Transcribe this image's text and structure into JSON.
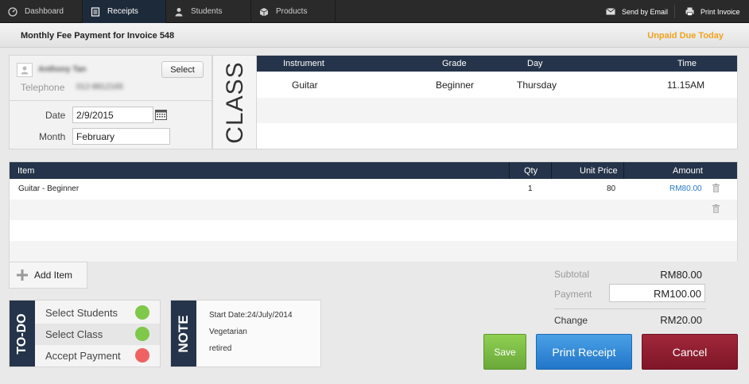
{
  "nav": {
    "tabs": [
      {
        "label": "Dashboard",
        "icon": "dashboard-icon"
      },
      {
        "label": "Receipts",
        "icon": "receipt-icon"
      },
      {
        "label": "Students",
        "icon": "person-icon"
      },
      {
        "label": "Products",
        "icon": "box-icon"
      }
    ],
    "actions": [
      {
        "label": "Send by Email",
        "icon": "envelope-icon"
      },
      {
        "label": "Print Invoice",
        "icon": "printer-icon"
      }
    ],
    "active_tab": "Receipts"
  },
  "header": {
    "title": "Monthly Fee Payment for Invoice 548",
    "status": "Unpaid Due Today",
    "status_color": "#f0a31e"
  },
  "student": {
    "name": "Anthony Tan",
    "telephone_label": "Telephone",
    "telephone": "012-8812165",
    "select_label": "Select",
    "date_label": "Date",
    "date_value": "2/9/2015",
    "month_label": "Month",
    "month_value": "February"
  },
  "class_section": {
    "label": "CLASS",
    "headers": {
      "instrument": "Instrument",
      "grade": "Grade",
      "day": "Day",
      "time": "Time"
    },
    "rows": [
      {
        "instrument": "Guitar",
        "grade": "Beginner",
        "day": "Thursday",
        "time": "11.15AM"
      }
    ]
  },
  "items": {
    "headers": {
      "item": "Item",
      "qty": "Qty",
      "unit_price": "Unit Price",
      "amount": "Amount"
    },
    "rows": [
      {
        "item": "Guitar - Beginner",
        "qty": "1",
        "unit_price": "80",
        "amount": "RM80.00"
      }
    ],
    "add_label": "Add Item"
  },
  "totals": {
    "subtotal_label": "Subtotal",
    "subtotal": "RM80.00",
    "payment_label": "Payment",
    "payment": "RM100.00",
    "change_label": "Change",
    "change": "RM20.00"
  },
  "todo": {
    "label": "TO-DO",
    "items": [
      {
        "label": "Select Students",
        "status": "done",
        "color": "#7fc84a"
      },
      {
        "label": "Select Class",
        "status": "done",
        "color": "#7fc84a"
      },
      {
        "label": "Accept Payment",
        "status": "pending",
        "color": "#f06262"
      }
    ]
  },
  "note": {
    "label": "NOTE",
    "lines": [
      "Start Date:24/July/2014",
      "Vegetarian",
      "retired"
    ]
  },
  "actions": {
    "save": "Save",
    "print_receipt": "Print Receipt",
    "cancel": "Cancel"
  },
  "colors": {
    "navy": "#25344a",
    "save_green": "#7fc84a",
    "print_blue": "#2c86d6",
    "cancel_red": "#8e1e30",
    "amount_link": "#2a7bc6"
  }
}
